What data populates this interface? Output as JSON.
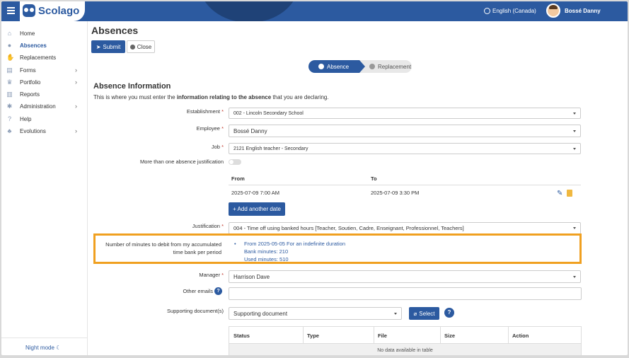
{
  "app": {
    "name": "Scolago"
  },
  "header": {
    "language": "English (Canada)",
    "user_name": "Bossé Danny"
  },
  "sidebar": {
    "items": [
      {
        "label": "Home",
        "icon": "home-icon",
        "glyph": "⌂",
        "active": false,
        "has_children": false
      },
      {
        "label": "Absences",
        "icon": "user-absence-icon",
        "glyph": "●",
        "active": true,
        "has_children": false
      },
      {
        "label": "Replacements",
        "icon": "handshake-icon",
        "glyph": "✋",
        "active": false,
        "has_children": false
      },
      {
        "label": "Forms",
        "icon": "form-icon",
        "glyph": "▤",
        "active": false,
        "has_children": true
      },
      {
        "label": "Portfolio",
        "icon": "trophy-icon",
        "glyph": "♛",
        "active": false,
        "has_children": true
      },
      {
        "label": "Reports",
        "icon": "report-icon",
        "glyph": "▥",
        "active": false,
        "has_children": false
      },
      {
        "label": "Administration",
        "icon": "gear-icon",
        "glyph": "✱",
        "active": false,
        "has_children": true
      },
      {
        "label": "Help",
        "icon": "question-icon",
        "glyph": "?",
        "active": false,
        "has_children": false
      },
      {
        "label": "Evolutions",
        "icon": "sprout-icon",
        "glyph": "♣",
        "active": false,
        "has_children": true
      }
    ],
    "chevron": "›",
    "night_mode": "Night mode ☾"
  },
  "page": {
    "title": "Absences",
    "submit_label": "Submit",
    "close_label": "Close",
    "steps": [
      {
        "label": "Absence"
      },
      {
        "label": "Replacement"
      }
    ],
    "section_title": "Absence Information",
    "intro_before": "This is where you must enter the ",
    "intro_bold": "information relating to the absence",
    "intro_after": " that you are declaring."
  },
  "form": {
    "establishment": {
      "label": "Establishment",
      "value": "002 - Lincoln Secondary School"
    },
    "employee": {
      "label": "Employee",
      "value": "Bossé Danny"
    },
    "job": {
      "label": "Job",
      "value": "2121 English teacher - Secondary"
    },
    "multi_justification": {
      "label": "More than one absence justification"
    },
    "dates": {
      "from_header": "From",
      "to_header": "To",
      "rows": [
        {
          "from": "2025-07-09 7:00 AM",
          "to": "2025-07-09 3:30 PM"
        }
      ],
      "add_label": "+ Add another date"
    },
    "justification": {
      "label": "Justification",
      "value": "004 - Time off using banked hours [Teacher, Soutien, Cadre, Enseignant, Professionnel, Teachers]"
    },
    "bank": {
      "label": "Number of minutes to debit from my accumulated time bank per period",
      "period": "From 2025-05-05 For an indefinite duration",
      "bank_minutes": "Bank minutes: 210",
      "used_minutes": "Used minutes: 510"
    },
    "manager": {
      "label": "Manager",
      "value": "Harrison Dave"
    },
    "other_emails": {
      "label": "Other emails",
      "value": ""
    },
    "supporting_docs": {
      "label": "Supporting document(s)",
      "select_value": "Supporting document",
      "select_button": "Select",
      "table_headers": [
        "Status",
        "Type",
        "File",
        "Size",
        "Action"
      ],
      "empty_text": "No data available in table"
    }
  }
}
